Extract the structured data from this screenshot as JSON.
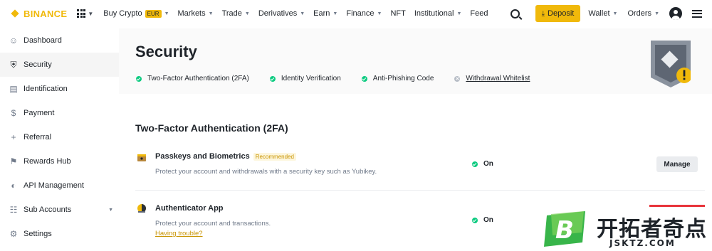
{
  "brand": {
    "name": "BINANCE",
    "color": "#f0b90b"
  },
  "nav": {
    "items": [
      {
        "label": "Buy Crypto",
        "badge": "EUR",
        "caret": true
      },
      {
        "label": "Markets",
        "caret": true
      },
      {
        "label": "Trade",
        "caret": true
      },
      {
        "label": "Derivatives",
        "caret": true
      },
      {
        "label": "Earn",
        "caret": true
      },
      {
        "label": "Finance",
        "caret": true
      },
      {
        "label": "NFT",
        "caret": false
      },
      {
        "label": "Institutional",
        "caret": true
      },
      {
        "label": "Feed",
        "caret": false
      }
    ],
    "deposit_label": "Deposit",
    "wallet_label": "Wallet",
    "orders_label": "Orders"
  },
  "sidebar": {
    "items": [
      {
        "label": "Dashboard",
        "icon": "user-icon",
        "glyph": "☺"
      },
      {
        "label": "Security",
        "icon": "shield-icon",
        "glyph": "⛨",
        "active": true
      },
      {
        "label": "Identification",
        "icon": "id-card-icon",
        "glyph": "▤"
      },
      {
        "label": "Payment",
        "icon": "dollar-icon",
        "glyph": "$"
      },
      {
        "label": "Referral",
        "icon": "add-user-icon",
        "glyph": "+"
      },
      {
        "label": "Rewards Hub",
        "icon": "trophy-icon",
        "glyph": "⚑"
      },
      {
        "label": "API Management",
        "icon": "api-icon",
        "glyph": "◐"
      },
      {
        "label": "Sub Accounts",
        "icon": "sub-accounts-icon",
        "glyph": "☷",
        "caret": true
      },
      {
        "label": "Settings",
        "icon": "settings-icon",
        "glyph": "⚙"
      }
    ]
  },
  "header": {
    "title": "Security",
    "checks": [
      {
        "label": "Two-Factor Authentication (2FA)",
        "status": "done"
      },
      {
        "label": "Identity Verification",
        "status": "done"
      },
      {
        "label": "Anti-Phishing Code",
        "status": "done"
      },
      {
        "label": "Withdrawal Whitelist",
        "status": "off"
      }
    ]
  },
  "section": {
    "title": "Two-Factor Authentication (2FA)",
    "rows": [
      {
        "title": "Passkeys and Biometrics",
        "badge": "Recommended",
        "description": "Protect your account and withdrawals with a security key such as Yubikey.",
        "status": "On",
        "action": "Manage"
      },
      {
        "title": "Authenticator App",
        "description": "Protect your account and transactions.",
        "link": "Having trouble?",
        "status": "On"
      }
    ]
  },
  "watermark": {
    "text": "开拓者奇点",
    "url": "JSKTZ.COM"
  },
  "colors": {
    "accent": "#f0b90b",
    "success": "#0ecb81",
    "danger": "#e8343b",
    "muted": "#707a8a"
  }
}
